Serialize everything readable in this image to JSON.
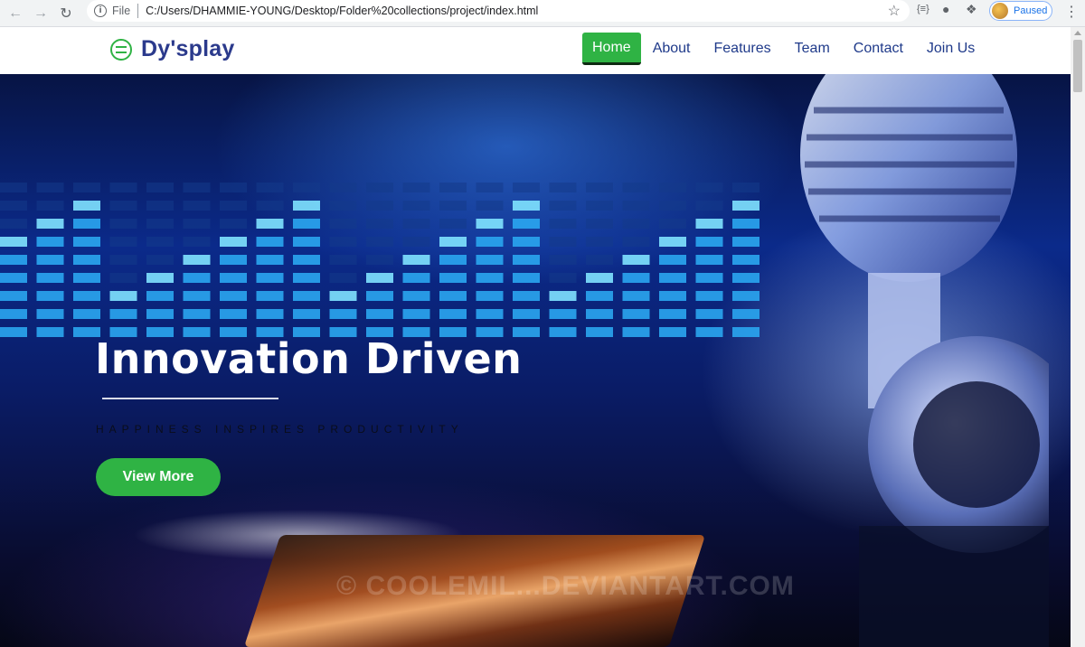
{
  "browser": {
    "back_icon": "arrow-left-icon",
    "forward_icon": "arrow-right-icon",
    "reload_icon": "reload-icon",
    "scheme_label": "File",
    "url": "C:/Users/DHAMMIE-YOUNG/Desktop/Folder%20collections/project/index.html",
    "profile_status": "Paused",
    "json_ext_label": "{≡}"
  },
  "site": {
    "logo_text": "Dy'splay",
    "nav": [
      {
        "label": "Home",
        "active": true
      },
      {
        "label": "About",
        "active": false
      },
      {
        "label": "Features",
        "active": false
      },
      {
        "label": "Team",
        "active": false
      },
      {
        "label": "Contact",
        "active": false
      },
      {
        "label": "Join Us",
        "active": false
      }
    ],
    "accent_color": "#2fb344",
    "brand_color": "#2b3a8c"
  },
  "hero": {
    "title": "Innovation Driven",
    "tagline": "HAPPINESS INSPIRES PRODUCTIVITY",
    "cta_label": "View More",
    "watermark": "© COOLEMIL...DEVIANTART.COM"
  }
}
